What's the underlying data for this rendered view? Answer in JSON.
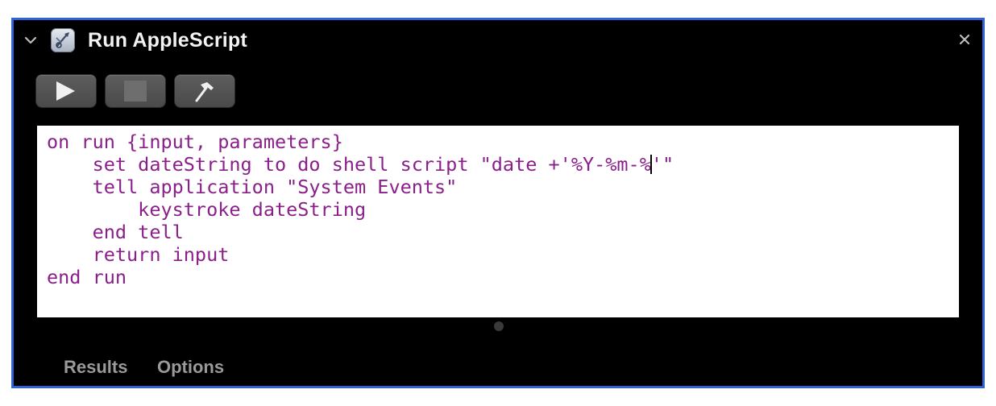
{
  "window": {
    "title": "Run AppleScript",
    "icon": "script-editor-icon",
    "accent_border": "#2f63d6"
  },
  "toolbar": {
    "buttons": [
      {
        "icon": "play-icon",
        "label": ""
      },
      {
        "icon": "stop-icon",
        "label": ""
      },
      {
        "icon": "hammer-icon",
        "label": ""
      }
    ]
  },
  "editor": {
    "text_color": "#8a1f8a",
    "lines": [
      "on run {input, parameters}",
      "    set dateString to do shell script \"date +'%Y-%m-%",
      "'\"",
      "    tell application \"System Events\"",
      "        keystroke dateString",
      "    end tell",
      "    return input",
      "end run"
    ]
  },
  "tabs": [
    {
      "label": "Results"
    },
    {
      "label": "Options"
    }
  ]
}
